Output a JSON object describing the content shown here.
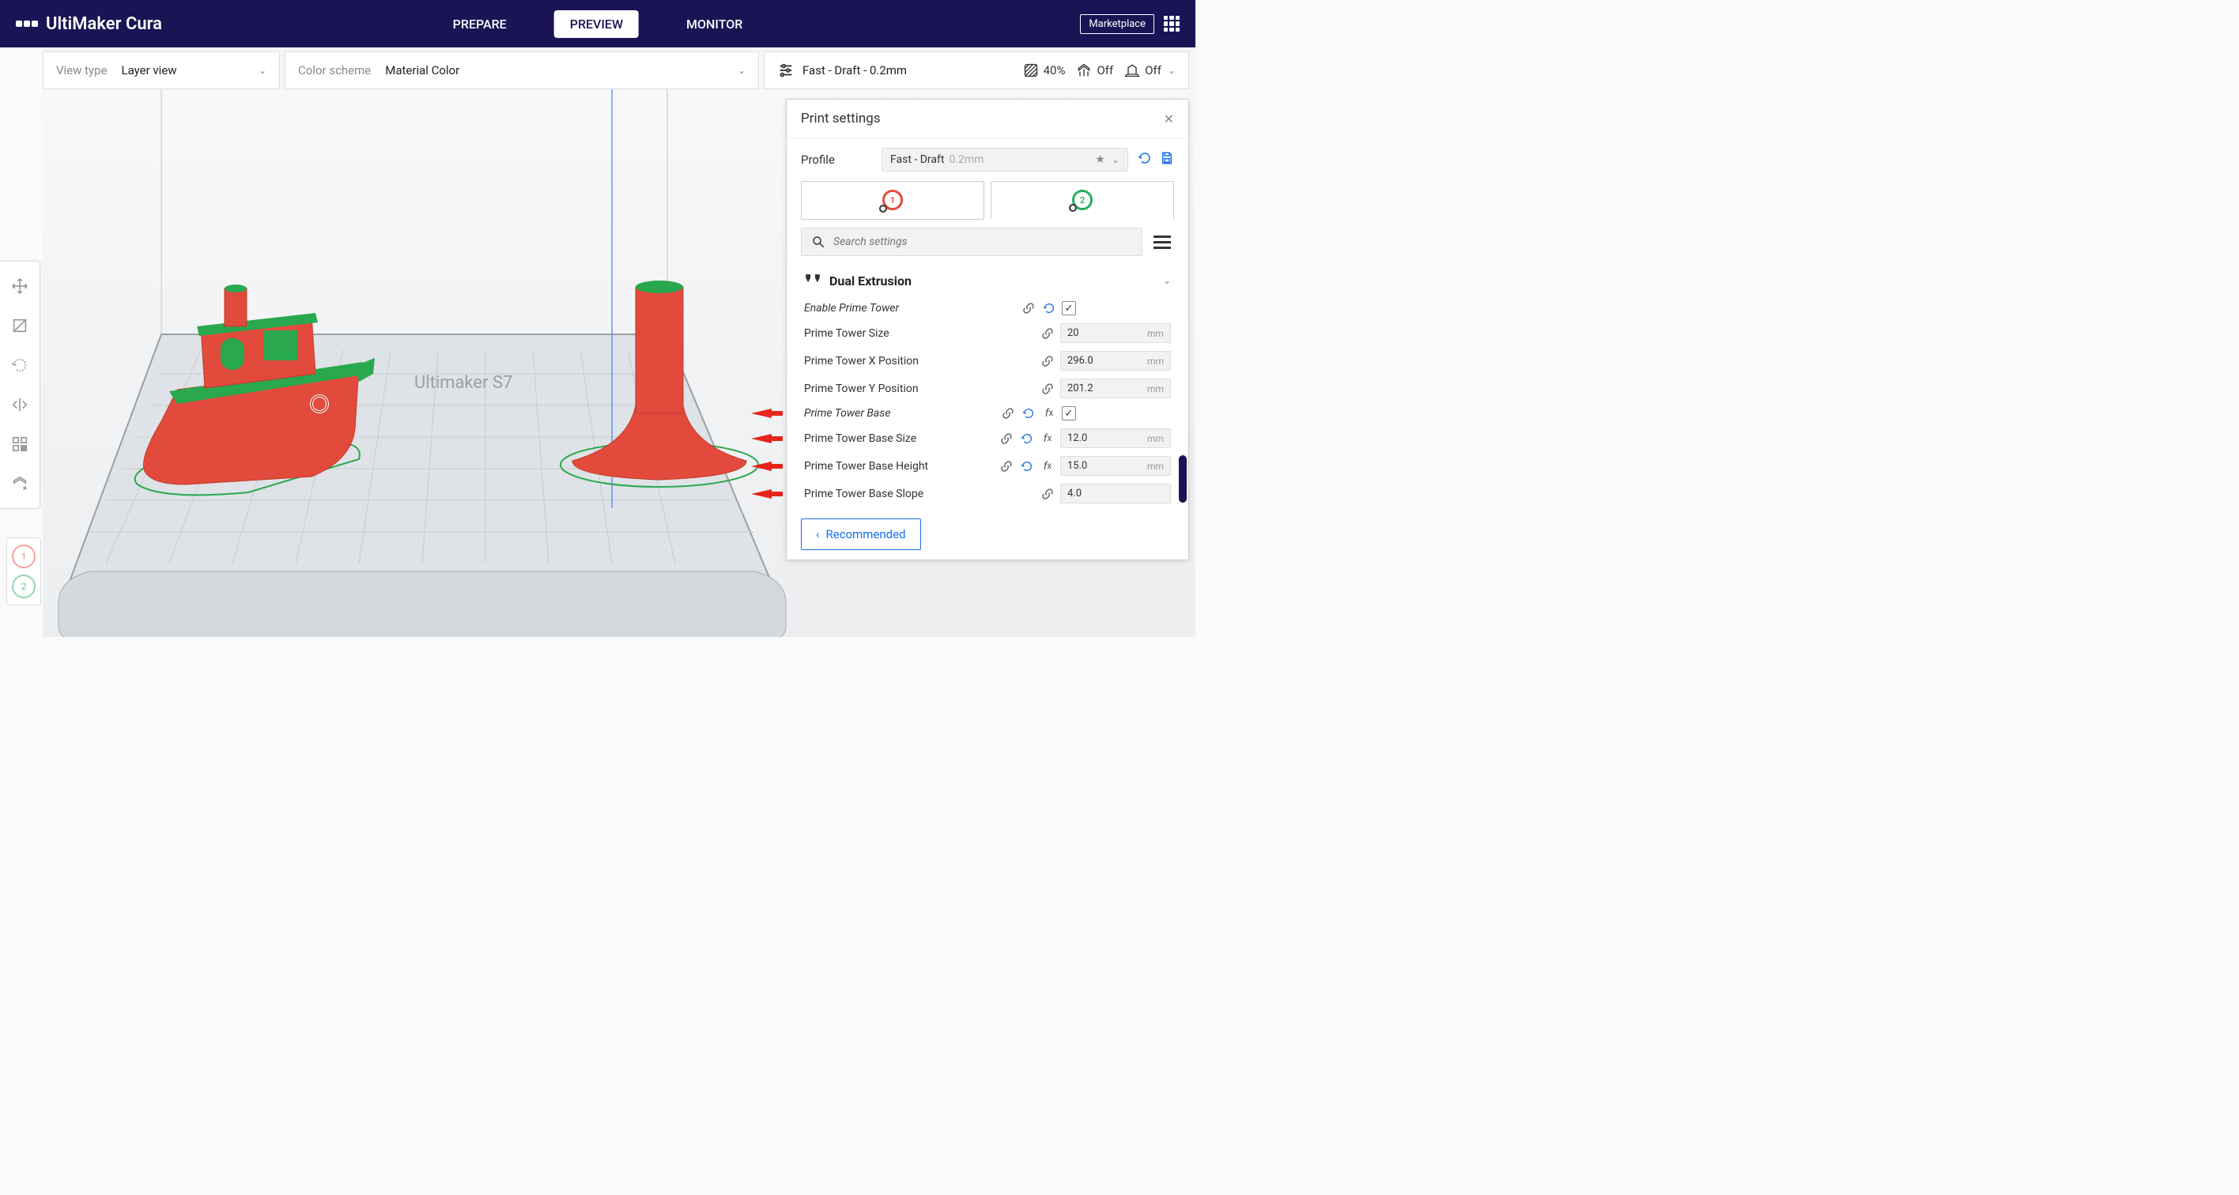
{
  "app": {
    "name": "UltiMaker Cura"
  },
  "tabs": {
    "prepare": "PREPARE",
    "preview": "PREVIEW",
    "monitor": "MONITOR"
  },
  "header": {
    "marketplace": "Marketplace"
  },
  "toolbar": {
    "viewtype_label": "View type",
    "viewtype_value": "Layer view",
    "colorscheme_label": "Color scheme",
    "colorscheme_value": "Material Color",
    "profile_summary": "Fast - Draft - 0.2mm",
    "infill_pct": "40%",
    "support": "Off",
    "adhesion": "Off"
  },
  "viewport": {
    "printer_label": "Ultimaker S7"
  },
  "panel": {
    "title": "Print settings",
    "profile_label": "Profile",
    "profile_name": "Fast - Draft",
    "profile_sub": "0.2mm",
    "search_placeholder": "Search settings",
    "section_title": "Dual Extrusion",
    "settings": {
      "enable_prime_tower": "Enable Prime Tower",
      "prime_tower_size": {
        "label": "Prime Tower Size",
        "value": "20",
        "unit": "mm"
      },
      "prime_tower_x": {
        "label": "Prime Tower X Position",
        "value": "296.0",
        "unit": "mm"
      },
      "prime_tower_y": {
        "label": "Prime Tower Y Position",
        "value": "201.2",
        "unit": "mm"
      },
      "prime_tower_base": "Prime Tower Base",
      "prime_tower_base_size": {
        "label": "Prime Tower Base Size",
        "value": "12.0",
        "unit": "mm"
      },
      "prime_tower_base_height": {
        "label": "Prime Tower Base Height",
        "value": "15.0",
        "unit": "mm"
      },
      "prime_tower_base_slope": {
        "label": "Prime Tower Base Slope",
        "value": "4.0",
        "unit": ""
      }
    },
    "recommended": "Recommended"
  },
  "extruders": {
    "e1": "1",
    "e2": "2"
  }
}
